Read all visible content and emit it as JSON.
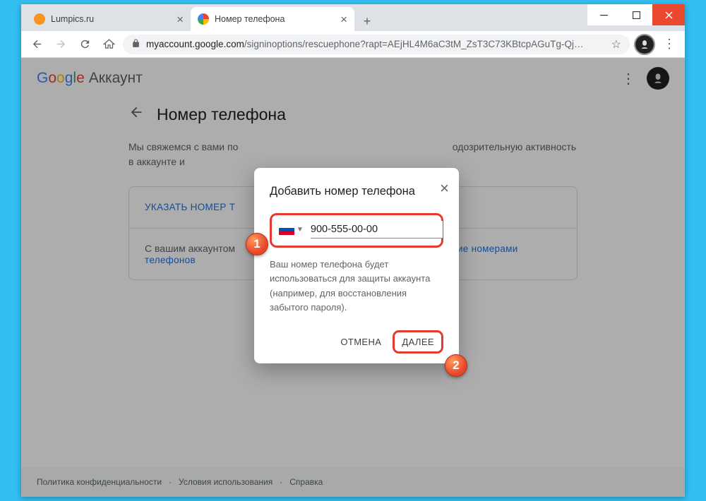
{
  "window": {
    "tabs": [
      {
        "title": "Lumpics.ru",
        "active": false,
        "favicon": "#f7931e"
      },
      {
        "title": "Номер телефона",
        "active": true,
        "favicon": "google"
      }
    ],
    "url_host": "myaccount.google.com",
    "url_path": "/signinoptions/rescuephone?rapt=AEjHL4M6aC3tM_ZsT3C73KBtcpAGuTg-Qj…"
  },
  "header": {
    "logo": "Google",
    "product": "Аккаунт"
  },
  "page": {
    "title": "Номер телефона",
    "description_left": "Мы свяжемся с вами по",
    "description_right": "одозрительную активность в аккаунте и",
    "specify_link": "УКАЗАТЬ НОМЕР Т",
    "account_text": "С вашим аккаунтом",
    "manage_link": "вление номерами телефонов"
  },
  "modal": {
    "title": "Добавить номер телефона",
    "phone_value": "900-555-00-00",
    "helper": "Ваш номер телефона будет использоваться для защиты аккаунта (например, для восстановления забытого пароля).",
    "cancel": "ОТМЕНА",
    "next": "ДАЛЕЕ"
  },
  "footer": {
    "privacy": "Политика конфиденциальности",
    "terms": "Условия использования",
    "help": "Справка"
  },
  "badges": {
    "one": "1",
    "two": "2"
  }
}
